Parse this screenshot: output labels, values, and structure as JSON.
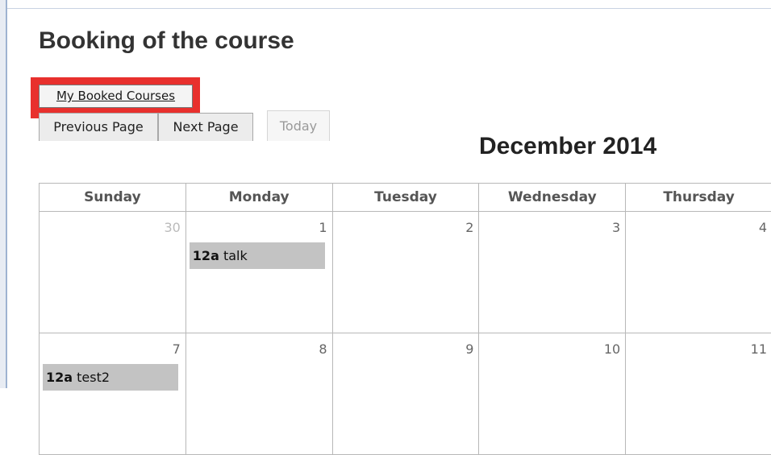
{
  "page": {
    "title": "Booking of the course"
  },
  "toolbar": {
    "booked_courses_label": "My Booked Courses",
    "prev_label": "Previous Page",
    "next_label": "Next Page",
    "today_label": "Today"
  },
  "calendar": {
    "month_title": "December 2014",
    "weekdays": [
      "Sunday",
      "Monday",
      "Tuesday",
      "Wednesday",
      "Thursday"
    ],
    "weeks": [
      {
        "days": [
          {
            "num": "30",
            "other_month": true,
            "event_time": "",
            "event_title": ""
          },
          {
            "num": "1",
            "other_month": false,
            "event_time": "12a",
            "event_title": "talk"
          },
          {
            "num": "2",
            "other_month": false,
            "event_time": "",
            "event_title": ""
          },
          {
            "num": "3",
            "other_month": false,
            "event_time": "",
            "event_title": ""
          },
          {
            "num": "4",
            "other_month": false,
            "event_time": "",
            "event_title": ""
          }
        ]
      },
      {
        "days": [
          {
            "num": "7",
            "other_month": false,
            "event_time": "12a",
            "event_title": "test2"
          },
          {
            "num": "8",
            "other_month": false,
            "event_time": "",
            "event_title": ""
          },
          {
            "num": "9",
            "other_month": false,
            "event_time": "",
            "event_title": ""
          },
          {
            "num": "10",
            "other_month": false,
            "event_time": "",
            "event_title": ""
          },
          {
            "num": "11",
            "other_month": false,
            "event_time": "",
            "event_title": ""
          }
        ]
      }
    ]
  },
  "colors": {
    "highlight": "#e8302d",
    "event_bg": "#c3c3c3",
    "border": "#b8b8b8"
  }
}
